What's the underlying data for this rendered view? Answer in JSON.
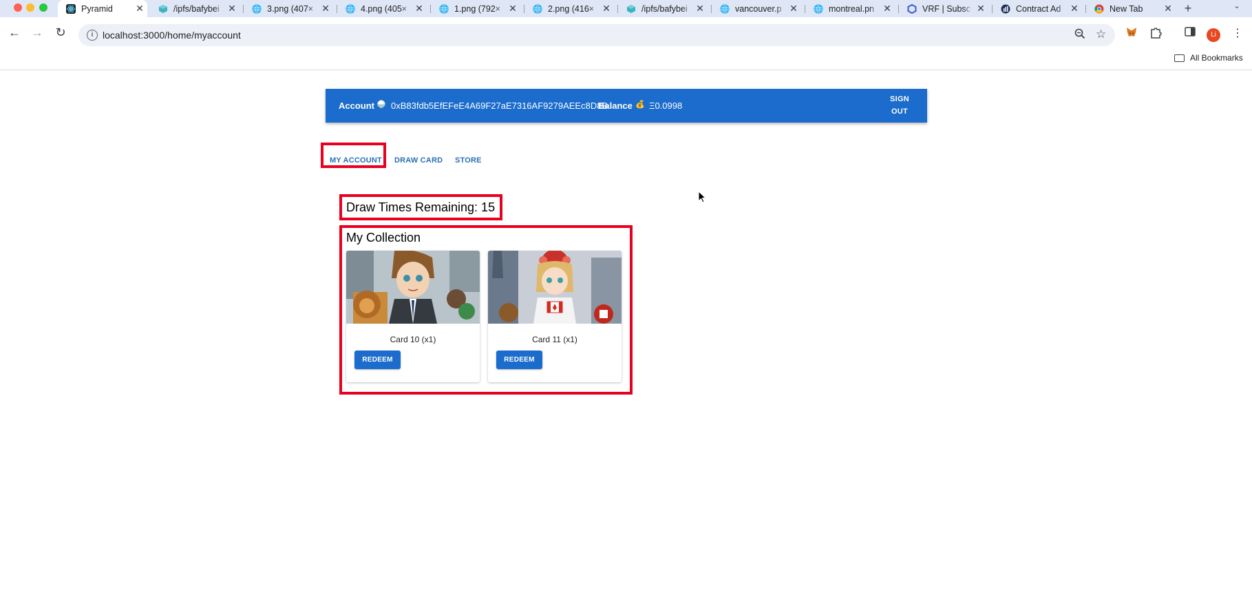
{
  "browser": {
    "tabs": [
      {
        "title": "Pyramid",
        "icon": "react-icon",
        "active": true
      },
      {
        "title": "/ipfs/bafybei",
        "icon": "ipfs-cube-icon"
      },
      {
        "title": "3.png (407×",
        "icon": "globe-icon"
      },
      {
        "title": "4.png (405×",
        "icon": "globe-icon"
      },
      {
        "title": "1.png (792×",
        "icon": "globe-icon"
      },
      {
        "title": "2.png (416×",
        "icon": "globe-icon"
      },
      {
        "title": "/ipfs/bafybei",
        "icon": "ipfs-cube-icon"
      },
      {
        "title": "vancouver.p",
        "icon": "globe-icon"
      },
      {
        "title": "montreal.pn",
        "icon": "globe-icon"
      },
      {
        "title": "VRF | Subsc",
        "icon": "chainlink-icon"
      },
      {
        "title": "Contract Ad",
        "icon": "etherscan-icon"
      },
      {
        "title": "New Tab",
        "icon": "chrome-icon"
      }
    ],
    "url": "localhost:3000/home/myaccount",
    "profile_initial": "Li",
    "bookmarks_label": "All Bookmarks"
  },
  "header": {
    "account_label": "Account",
    "account_emoji": "🍚",
    "account_address": "0xB83fdb5EfEFeE4A69F27aE7316AF9279AEEc8D8B",
    "balance_label": "Balance",
    "balance_emoji": "💰",
    "balance_value": "Ξ0.0998",
    "signout_line1": "SIGN",
    "signout_line2": "OUT"
  },
  "nav": {
    "tabs": [
      "MY ACCOUNT",
      "DRAW CARD",
      "STORE"
    ],
    "active": 0
  },
  "draw_times_label": "Draw Times Remaining: 15",
  "collection": {
    "title": "My Collection",
    "cards": [
      {
        "caption": "Card 10 (x1)",
        "button": "REDEEM"
      },
      {
        "caption": "Card 11 (x1)",
        "button": "REDEEM"
      }
    ]
  },
  "colors": {
    "appbar": "#1b6ccc",
    "highlight": "#e8001e",
    "nav_link": "#2a6fb6"
  }
}
